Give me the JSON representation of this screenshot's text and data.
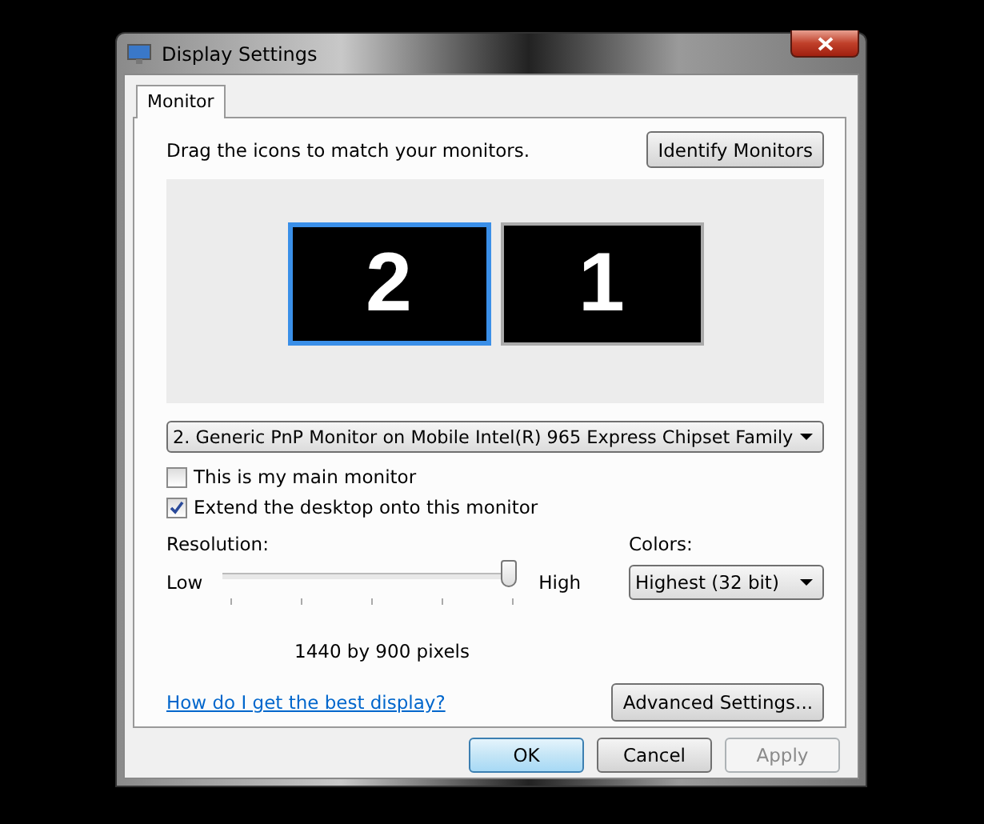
{
  "window": {
    "title": "Display Settings"
  },
  "tabs": [
    {
      "label": "Monitor",
      "selected": true
    }
  ],
  "instructions": "Drag the icons to match your monitors.",
  "identify_button": "Identify Monitors",
  "monitors": [
    {
      "number": "2",
      "selected": true
    },
    {
      "number": "1",
      "selected": false
    }
  ],
  "monitor_select": {
    "value": "2. Generic PnP Monitor on Mobile Intel(R) 965 Express Chipset Family"
  },
  "checkboxes": [
    {
      "label": "This is my main monitor",
      "checked": false
    },
    {
      "label": "Extend the desktop onto this monitor",
      "checked": true
    }
  ],
  "resolution": {
    "label": "Resolution:",
    "low": "Low",
    "high": "High",
    "level": 1,
    "reading": "1440 by 900 pixels"
  },
  "colors": {
    "label": "Colors:",
    "value": "Highest (32 bit)"
  },
  "help_link": "How do I get the best display?",
  "advanced_button": "Advanced Settings...",
  "buttons": [
    {
      "label": "OK",
      "default": true,
      "disabled": false
    },
    {
      "label": "Cancel",
      "default": false,
      "disabled": false
    },
    {
      "label": "Apply",
      "default": false,
      "disabled": true
    }
  ]
}
